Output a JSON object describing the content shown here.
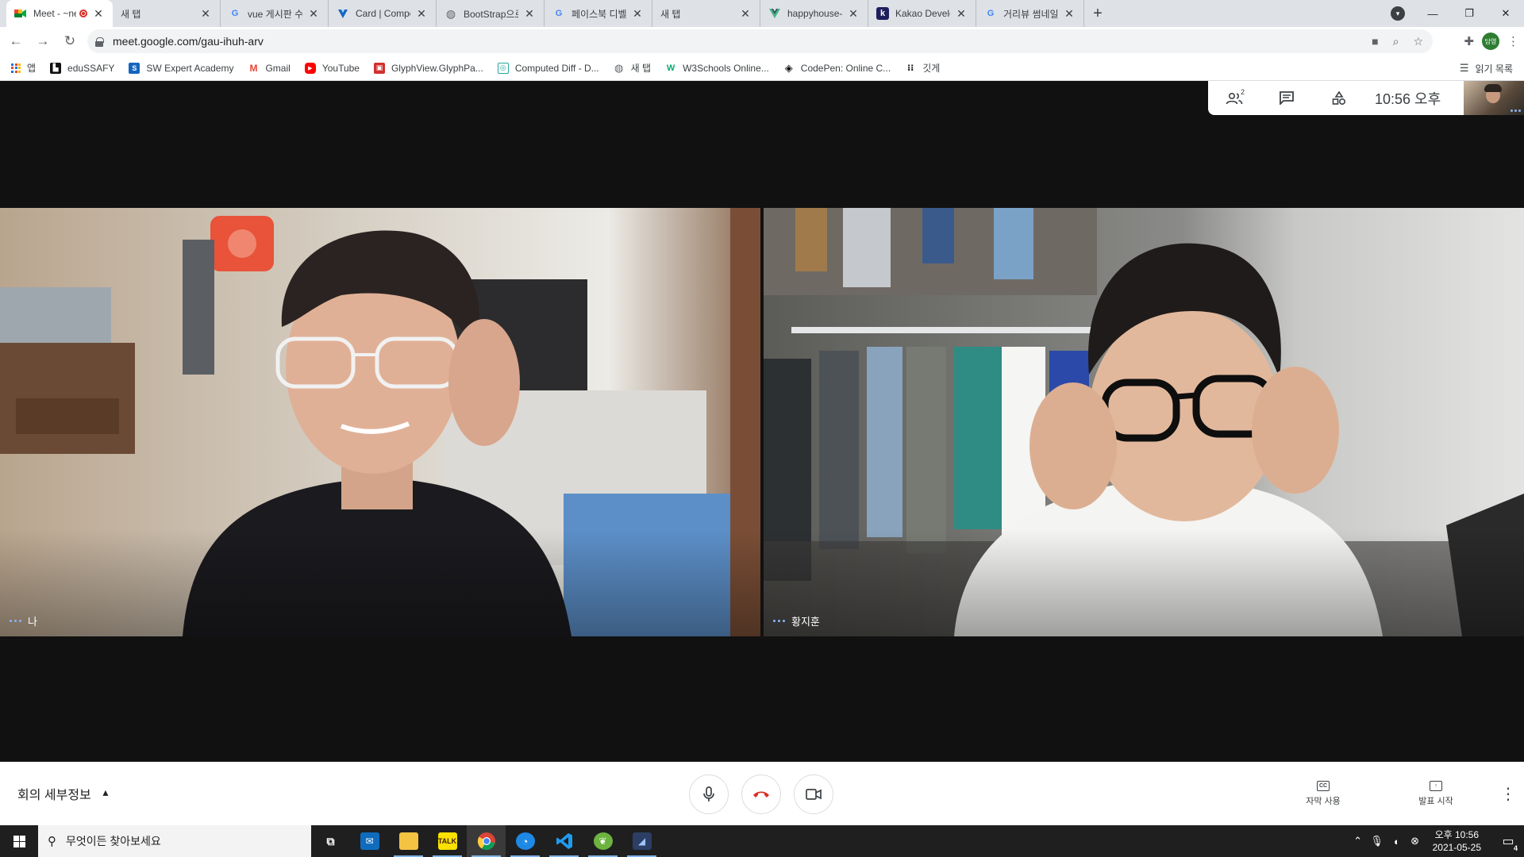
{
  "tabs": [
    {
      "title": "Meet - ~new",
      "favicon": "meet-icon",
      "active": true,
      "recording": true
    },
    {
      "title": "새 탭",
      "favicon": "none"
    },
    {
      "title": "vue 게시판 수정하기",
      "favicon": "google-icon"
    },
    {
      "title": "Card | Component",
      "favicon": "vuetify-icon"
    },
    {
      "title": "BootStrap으로 웹사",
      "favicon": "globe-icon"
    },
    {
      "title": "페이스북 디벨로퍼",
      "favicon": "google-icon"
    },
    {
      "title": "새 탭",
      "favicon": "none"
    },
    {
      "title": "happyhouse-front",
      "favicon": "vue-icon"
    },
    {
      "title": "Kakao Developers",
      "favicon": "kakao-icon"
    },
    {
      "title": "거리뷰 썸네일 - G",
      "favicon": "google-icon"
    }
  ],
  "address": {
    "url": "meet.google.com/gau-ihuh-arv"
  },
  "profile": {
    "initials": "담영"
  },
  "bookmarks": [
    {
      "label": "앱",
      "icon": "apps-grid-icon"
    },
    {
      "label": "eduSSAFY",
      "icon": "edussafy-icon"
    },
    {
      "label": "SW Expert Academy",
      "icon": "swea-icon"
    },
    {
      "label": "Gmail",
      "icon": "gmail-icon"
    },
    {
      "label": "YouTube",
      "icon": "youtube-icon"
    },
    {
      "label": "GlyphView.GlyphPa...",
      "icon": "glyphview-icon"
    },
    {
      "label": "Computed Diff - D...",
      "icon": "computed-diff-icon"
    },
    {
      "label": "새 탭",
      "icon": "globe-icon"
    },
    {
      "label": "W3Schools Online...",
      "icon": "w3schools-icon"
    },
    {
      "label": "CodePen: Online C...",
      "icon": "codepen-icon"
    },
    {
      "label": "깃게",
      "icon": "dots-icon"
    }
  ],
  "reading_list": "읽기 목록",
  "meet": {
    "participant_count": "2",
    "clock": "10:56 오후",
    "participants": [
      {
        "name": "나"
      },
      {
        "name": "황지훈"
      }
    ],
    "meeting_details": "회의 세부정보",
    "captions_label": "자막 사용",
    "present_label": "발표 시작"
  },
  "taskbar": {
    "search_placeholder": "무엇이든 찾아보세요",
    "time": "오후 10:56",
    "date": "2021-05-25",
    "notification_count": "4"
  },
  "colors": {
    "hangup": "#d93025",
    "accent": "#1a73e8",
    "stage_bg": "#111111"
  }
}
